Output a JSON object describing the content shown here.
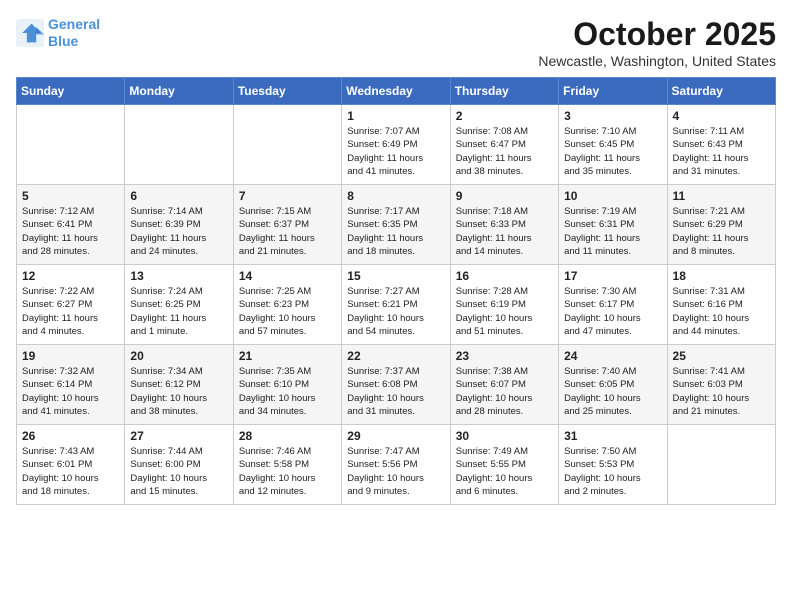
{
  "logo": {
    "line1": "General",
    "line2": "Blue"
  },
  "title": "October 2025",
  "subtitle": "Newcastle, Washington, United States",
  "weekdays": [
    "Sunday",
    "Monday",
    "Tuesday",
    "Wednesday",
    "Thursday",
    "Friday",
    "Saturday"
  ],
  "weeks": [
    [
      {
        "day": "",
        "info": ""
      },
      {
        "day": "",
        "info": ""
      },
      {
        "day": "",
        "info": ""
      },
      {
        "day": "1",
        "info": "Sunrise: 7:07 AM\nSunset: 6:49 PM\nDaylight: 11 hours\nand 41 minutes."
      },
      {
        "day": "2",
        "info": "Sunrise: 7:08 AM\nSunset: 6:47 PM\nDaylight: 11 hours\nand 38 minutes."
      },
      {
        "day": "3",
        "info": "Sunrise: 7:10 AM\nSunset: 6:45 PM\nDaylight: 11 hours\nand 35 minutes."
      },
      {
        "day": "4",
        "info": "Sunrise: 7:11 AM\nSunset: 6:43 PM\nDaylight: 11 hours\nand 31 minutes."
      }
    ],
    [
      {
        "day": "5",
        "info": "Sunrise: 7:12 AM\nSunset: 6:41 PM\nDaylight: 11 hours\nand 28 minutes."
      },
      {
        "day": "6",
        "info": "Sunrise: 7:14 AM\nSunset: 6:39 PM\nDaylight: 11 hours\nand 24 minutes."
      },
      {
        "day": "7",
        "info": "Sunrise: 7:15 AM\nSunset: 6:37 PM\nDaylight: 11 hours\nand 21 minutes."
      },
      {
        "day": "8",
        "info": "Sunrise: 7:17 AM\nSunset: 6:35 PM\nDaylight: 11 hours\nand 18 minutes."
      },
      {
        "day": "9",
        "info": "Sunrise: 7:18 AM\nSunset: 6:33 PM\nDaylight: 11 hours\nand 14 minutes."
      },
      {
        "day": "10",
        "info": "Sunrise: 7:19 AM\nSunset: 6:31 PM\nDaylight: 11 hours\nand 11 minutes."
      },
      {
        "day": "11",
        "info": "Sunrise: 7:21 AM\nSunset: 6:29 PM\nDaylight: 11 hours\nand 8 minutes."
      }
    ],
    [
      {
        "day": "12",
        "info": "Sunrise: 7:22 AM\nSunset: 6:27 PM\nDaylight: 11 hours\nand 4 minutes."
      },
      {
        "day": "13",
        "info": "Sunrise: 7:24 AM\nSunset: 6:25 PM\nDaylight: 11 hours\nand 1 minute."
      },
      {
        "day": "14",
        "info": "Sunrise: 7:25 AM\nSunset: 6:23 PM\nDaylight: 10 hours\nand 57 minutes."
      },
      {
        "day": "15",
        "info": "Sunrise: 7:27 AM\nSunset: 6:21 PM\nDaylight: 10 hours\nand 54 minutes."
      },
      {
        "day": "16",
        "info": "Sunrise: 7:28 AM\nSunset: 6:19 PM\nDaylight: 10 hours\nand 51 minutes."
      },
      {
        "day": "17",
        "info": "Sunrise: 7:30 AM\nSunset: 6:17 PM\nDaylight: 10 hours\nand 47 minutes."
      },
      {
        "day": "18",
        "info": "Sunrise: 7:31 AM\nSunset: 6:16 PM\nDaylight: 10 hours\nand 44 minutes."
      }
    ],
    [
      {
        "day": "19",
        "info": "Sunrise: 7:32 AM\nSunset: 6:14 PM\nDaylight: 10 hours\nand 41 minutes."
      },
      {
        "day": "20",
        "info": "Sunrise: 7:34 AM\nSunset: 6:12 PM\nDaylight: 10 hours\nand 38 minutes."
      },
      {
        "day": "21",
        "info": "Sunrise: 7:35 AM\nSunset: 6:10 PM\nDaylight: 10 hours\nand 34 minutes."
      },
      {
        "day": "22",
        "info": "Sunrise: 7:37 AM\nSunset: 6:08 PM\nDaylight: 10 hours\nand 31 minutes."
      },
      {
        "day": "23",
        "info": "Sunrise: 7:38 AM\nSunset: 6:07 PM\nDaylight: 10 hours\nand 28 minutes."
      },
      {
        "day": "24",
        "info": "Sunrise: 7:40 AM\nSunset: 6:05 PM\nDaylight: 10 hours\nand 25 minutes."
      },
      {
        "day": "25",
        "info": "Sunrise: 7:41 AM\nSunset: 6:03 PM\nDaylight: 10 hours\nand 21 minutes."
      }
    ],
    [
      {
        "day": "26",
        "info": "Sunrise: 7:43 AM\nSunset: 6:01 PM\nDaylight: 10 hours\nand 18 minutes."
      },
      {
        "day": "27",
        "info": "Sunrise: 7:44 AM\nSunset: 6:00 PM\nDaylight: 10 hours\nand 15 minutes."
      },
      {
        "day": "28",
        "info": "Sunrise: 7:46 AM\nSunset: 5:58 PM\nDaylight: 10 hours\nand 12 minutes."
      },
      {
        "day": "29",
        "info": "Sunrise: 7:47 AM\nSunset: 5:56 PM\nDaylight: 10 hours\nand 9 minutes."
      },
      {
        "day": "30",
        "info": "Sunrise: 7:49 AM\nSunset: 5:55 PM\nDaylight: 10 hours\nand 6 minutes."
      },
      {
        "day": "31",
        "info": "Sunrise: 7:50 AM\nSunset: 5:53 PM\nDaylight: 10 hours\nand 2 minutes."
      },
      {
        "day": "",
        "info": ""
      }
    ]
  ]
}
